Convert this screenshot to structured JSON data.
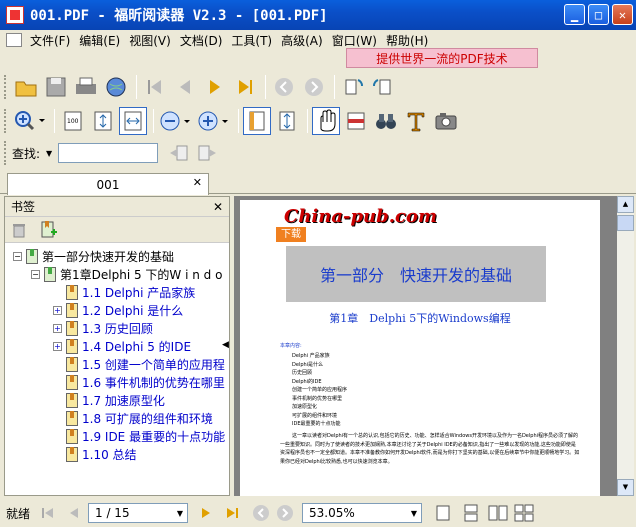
{
  "window": {
    "title": "001.PDF - 福昕阅读器 V2.3 - [001.PDF]"
  },
  "menu": [
    "文件(F)",
    "编辑(E)",
    "视图(V)",
    "文档(D)",
    "工具(T)",
    "高级(A)",
    "窗口(W)",
    "帮助(H)"
  ],
  "promo": "提供世界一流的PDF技术",
  "find": {
    "label": "查找:",
    "value": ""
  },
  "tab": {
    "label": "001"
  },
  "sidebar": {
    "title": "书签",
    "items": [
      {
        "label": "第一部分快速开发的基础",
        "level": 0
      },
      {
        "label": "第1章Delphi 5 下的W i n d o",
        "level": 1
      },
      {
        "label": "1.1 Delphi 产品家族",
        "level": 2
      },
      {
        "label": "1.2 Delphi 是什么",
        "level": 2
      },
      {
        "label": "1.3 历史回顾",
        "level": 2
      },
      {
        "label": "1.4 Delphi 5 的IDE",
        "level": 2
      },
      {
        "label": "1.5 创建一个简单的应用程",
        "level": 2
      },
      {
        "label": "1.6 事件机制的优势在哪里",
        "level": 2
      },
      {
        "label": "1.7 加速原型化",
        "level": 2
      },
      {
        "label": "1.8 可扩展的组件和环境",
        "level": 2
      },
      {
        "label": "1.9 IDE 最重要的十点功能",
        "level": 2
      },
      {
        "label": "1.10 总结",
        "level": 2
      }
    ]
  },
  "document": {
    "logo": "China-pub.com",
    "download": "下载",
    "part_title": "第一部分　快速开发的基础",
    "chapter_title": "第1章　Delphi 5下的Windows编程",
    "contents_label": "本章内容:",
    "toc": [
      "Delphi 产品家族",
      "Delphi是什么",
      "历史回顾",
      "Delphi的IDE",
      "创建一个简单的应用程序",
      "事件机制的优势在哪里",
      "加速原型化",
      "可扩展的组件和环境",
      "IDE最重要的十点功能"
    ],
    "body": "这一章以读者对Delphi有一个总的认识,包括它的历史、功能、怎样适合Windows开发环境以及作为一名Delphi程序员必须了解的一些重要知识。同时为了使读者的技术更加娴熟,本章还讨论了关于Delphi IDE的必备知识,指出了一些难以发现的功能,这些功能即使是资深程序员也不一定全都知道。本章不准备教你如何开发Delphi软件,而是为你打下坚实的基础,以便在后续章节中你能更顺畅地学习。如果你已经对Delphi比较熟悉,也可以快速浏览本章。"
  },
  "status": {
    "ready": "就绪",
    "page": "1 / 15",
    "zoom": "53.05%"
  }
}
